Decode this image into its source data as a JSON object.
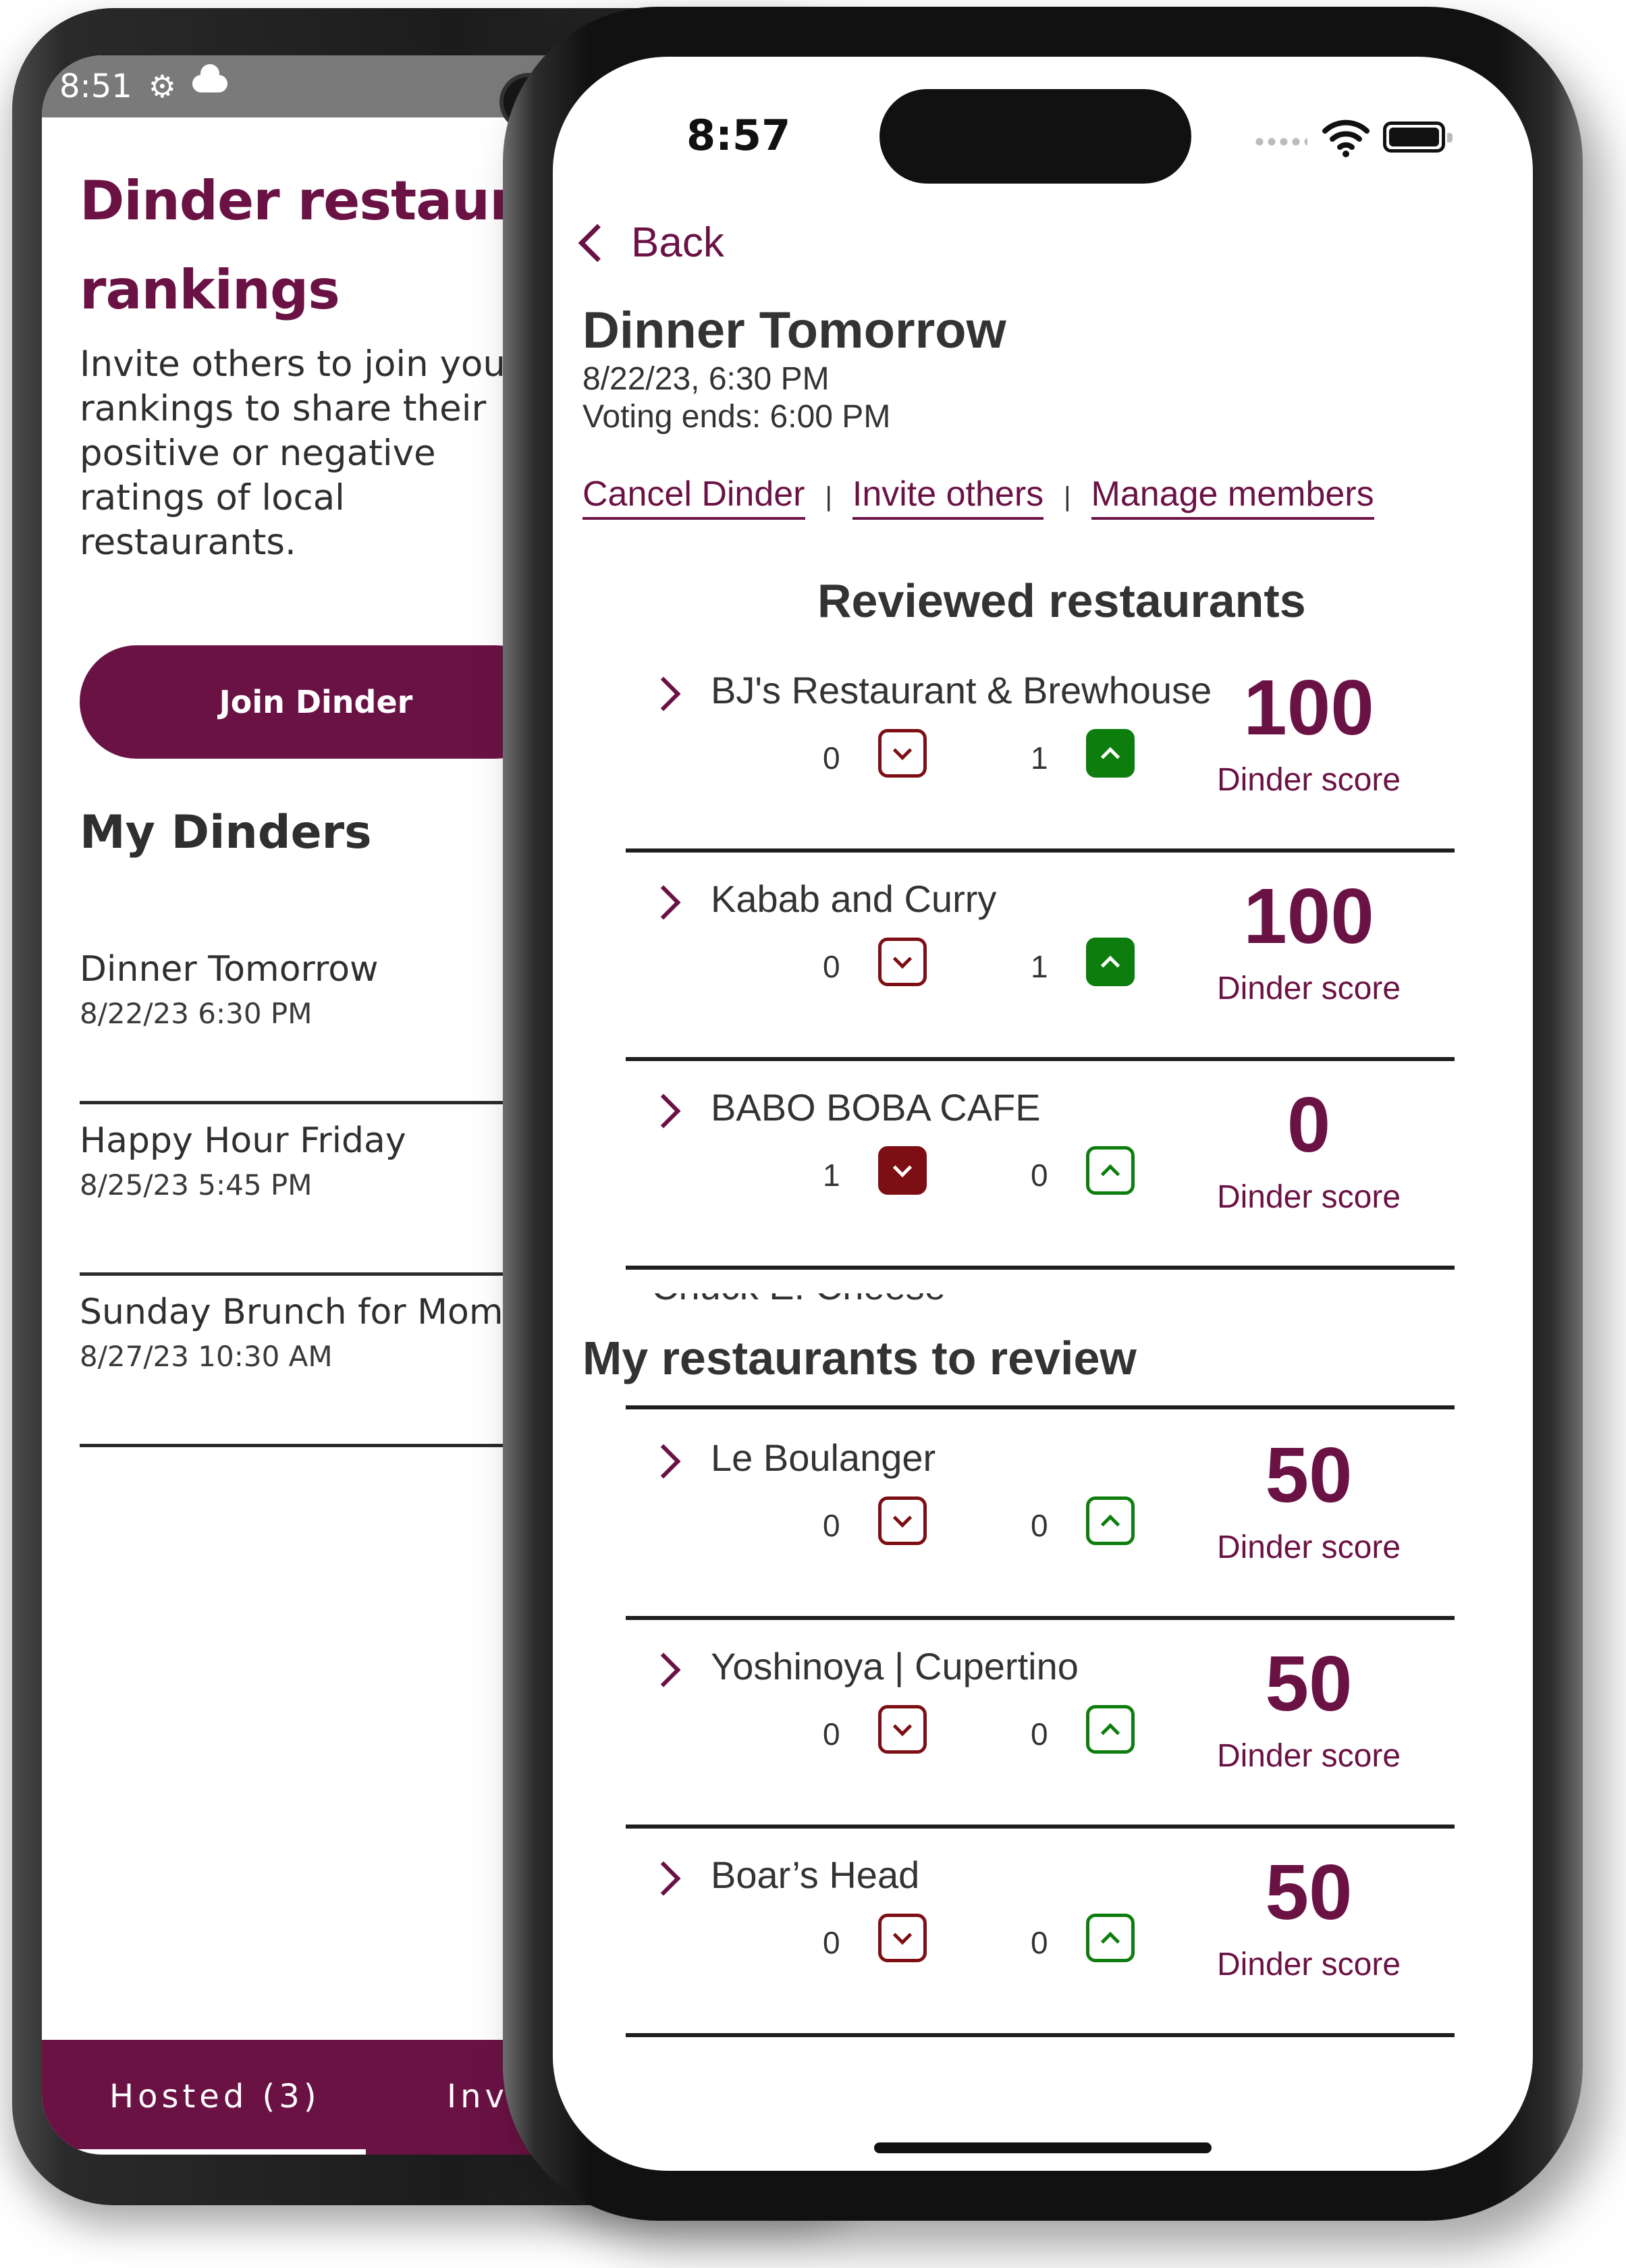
{
  "colors": {
    "brand": "#6b1245",
    "downvote": "#7d0f14",
    "upvote": "#0d7d0d"
  },
  "android": {
    "status_time": "8:51",
    "status_icons": [
      "gear-icon",
      "cloud-icon"
    ],
    "title_line1": "Dinder restaurant",
    "title_line2": "rankings",
    "subtitle": "Invite others to join your rankings to share their positive or negative ratings of local restaurants.",
    "join_button": "Join Dinder",
    "my_dinders_heading": "My Dinders",
    "dinders": [
      {
        "name": "Dinner Tomorrow",
        "date": "8/22/23 6:30 PM"
      },
      {
        "name": "Happy Hour Friday",
        "date": "8/25/23 5:45 PM"
      },
      {
        "name": "Sunday Brunch for Mom",
        "date": "8/27/23 10:30 AM"
      }
    ],
    "tabs": [
      "Hosted (3)",
      "Invited"
    ]
  },
  "iphone": {
    "status_time": "8:57",
    "back_label": "Back",
    "title": "Dinner Tomorrow",
    "datetime": "8/22/23, 6:30 PM",
    "voting_ends": "Voting ends: 6:00 PM",
    "links": {
      "cancel": "Cancel Dinder",
      "invite": "Invite others",
      "manage": "Manage members"
    },
    "reviewed_heading": "Reviewed restaurants",
    "reviewed": [
      {
        "name": "BJ's Restaurant & Brewhouse",
        "down": "0",
        "up": "1",
        "down_active": false,
        "up_active": true,
        "score": "100",
        "score_label": "Dinder score"
      },
      {
        "name": "Kabab and Curry",
        "down": "0",
        "up": "1",
        "down_active": false,
        "up_active": true,
        "score": "100",
        "score_label": "Dinder score"
      },
      {
        "name": "BABO BOBA CAFE",
        "down": "1",
        "up": "0",
        "down_active": true,
        "up_active": false,
        "score": "0",
        "score_label": "Dinder score"
      }
    ],
    "peek_name": "Chuck E. Cheese",
    "to_review_heading": "My restaurants to review",
    "to_review": [
      {
        "name": "Le Boulanger",
        "down": "0",
        "up": "0",
        "down_active": false,
        "up_active": false,
        "score": "50",
        "score_label": "Dinder score"
      },
      {
        "name": "Yoshinoya | Cupertino",
        "down": "0",
        "up": "0",
        "down_active": false,
        "up_active": false,
        "score": "50",
        "score_label": "Dinder score"
      },
      {
        "name": "Boar’s Head",
        "down": "0",
        "up": "0",
        "down_active": false,
        "up_active": false,
        "score": "50",
        "score_label": "Dinder score"
      }
    ]
  }
}
